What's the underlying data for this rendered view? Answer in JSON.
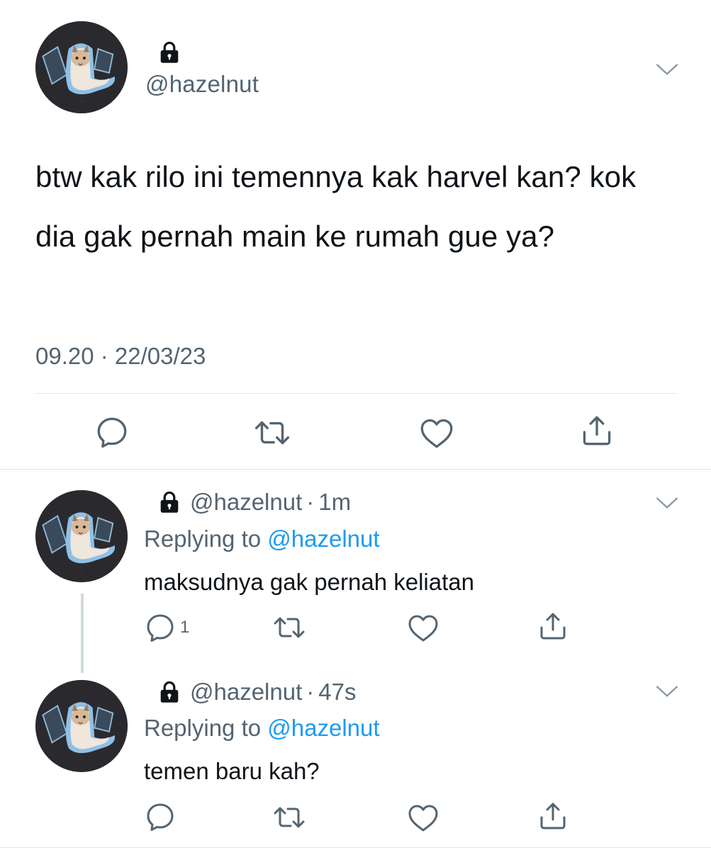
{
  "main_tweet": {
    "handle": "@hazelnut",
    "text": "btw kak rilo ini temennya kak harvel kan? kok dia gak pernah main ke rumah gue ya?",
    "timestamp": "09.20 · 22/03/23",
    "icons": [
      "lock-icon",
      "chevron-down-icon",
      "reply-icon",
      "retweet-icon",
      "like-icon",
      "share-icon"
    ]
  },
  "replies": [
    {
      "handle": "@hazelnut",
      "separator": "·",
      "time": "1m",
      "replying_label": "Replying to ",
      "replying_to": "@hazelnut",
      "text": "maksudnya gak pernah keliatan",
      "reply_count": "1"
    },
    {
      "handle": "@hazelnut",
      "separator": "·",
      "time": "47s",
      "replying_label": "Replying to ",
      "replying_to": "@hazelnut",
      "text": "temen baru kah?",
      "reply_count": ""
    }
  ],
  "colors": {
    "text": "#0f1419",
    "secondary": "#536471",
    "accent": "#1d9bf0",
    "divider": "#e1e5e8"
  }
}
